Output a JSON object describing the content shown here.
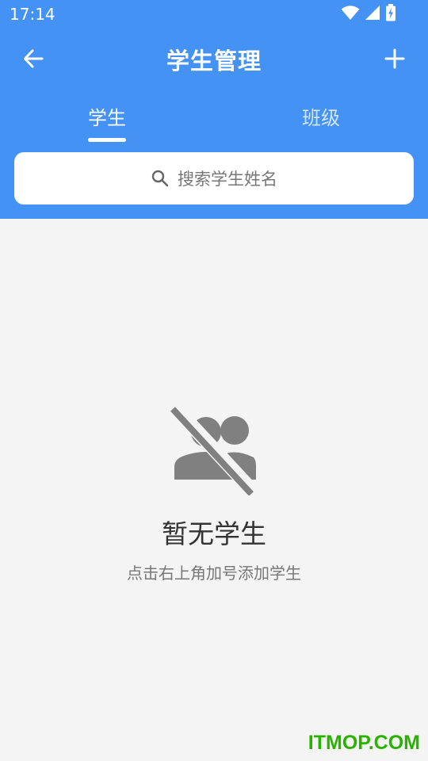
{
  "status_bar": {
    "time": "17:14",
    "icons": [
      "wifi-icon",
      "signal-icon",
      "battery-charging-icon"
    ]
  },
  "toolbar": {
    "title": "学生管理",
    "back_icon": "arrow-left-icon",
    "add_icon": "plus-icon"
  },
  "tabs": [
    {
      "label": "学生",
      "active": true
    },
    {
      "label": "班级",
      "active": false
    }
  ],
  "search": {
    "placeholder": "搜索学生姓名",
    "icon": "search-icon"
  },
  "empty_state": {
    "icon": "no-people-icon",
    "title": "暂无学生",
    "subtitle": "点击右上角加号添加学生"
  },
  "watermark": {
    "text": "ITMOP.COM"
  },
  "colors": {
    "primary": "#4592f5",
    "background": "#f4f4f4",
    "icon_gray": "#808080",
    "watermark": "#27b300"
  }
}
